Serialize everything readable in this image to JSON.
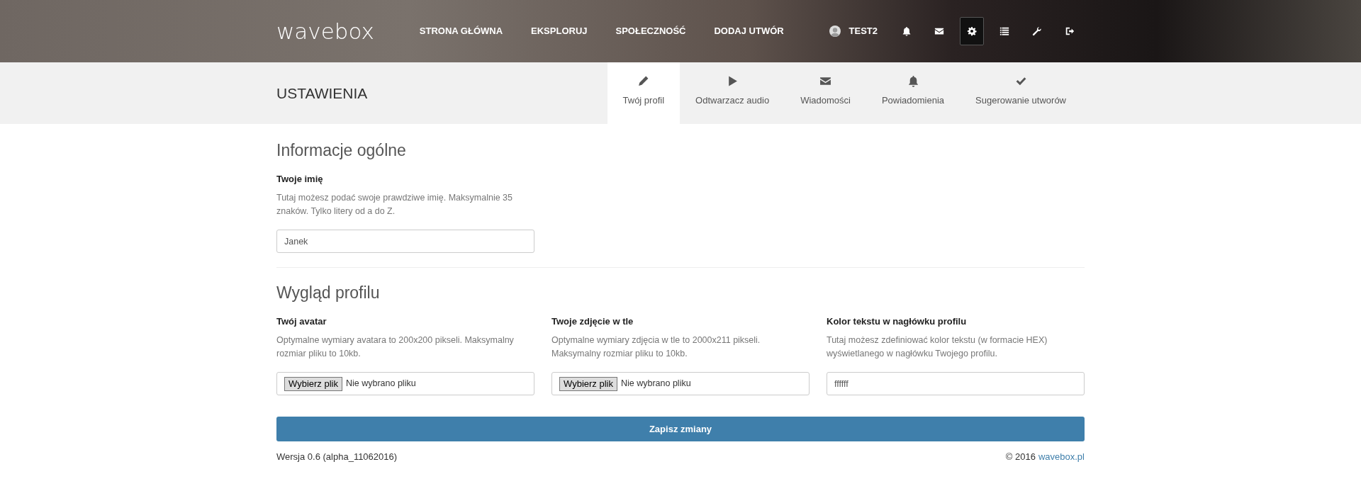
{
  "header": {
    "logo": "wavebox",
    "nav_links": [
      "STRONA GŁÓWNA",
      "EKSPLORUJ",
      "SPOŁECZNOŚĆ",
      "DODAJ UTWÓR"
    ],
    "user": {
      "name": "TEST2"
    },
    "icons": [
      {
        "kind": "bell",
        "selected": false
      },
      {
        "kind": "envelope",
        "selected": false
      },
      {
        "kind": "gear",
        "selected": true
      },
      {
        "kind": "list",
        "selected": false
      },
      {
        "kind": "wrench",
        "selected": false
      },
      {
        "kind": "signout",
        "selected": false
      }
    ]
  },
  "page_title": "USTAWIENIA",
  "tabs": [
    {
      "label": "Twój profil",
      "kind": "pencil",
      "selected": true
    },
    {
      "label": "Odtwarzacz audio",
      "kind": "play",
      "selected": false
    },
    {
      "label": "Wiadomości",
      "kind": "envelope",
      "selected": false
    },
    {
      "label": "Powiadomienia",
      "kind": "bell",
      "selected": false
    },
    {
      "label": "Sugerowanie utworów",
      "kind": "check",
      "selected": false
    }
  ],
  "sections": [
    {
      "title": "Informacje ogólne",
      "fields": [
        {
          "kind": "text",
          "label": "Twoje imię",
          "help": "Tutaj możesz podać swoje prawdziwe imię. Maksymalnie 35 znaków. Tylko litery od a do Z.",
          "value": "Janek"
        }
      ]
    },
    {
      "title": "Wygląd profilu",
      "fields": [
        {
          "kind": "file",
          "label": "Twój avatar",
          "help": "Optymalne wymiary avatara to 200x200 pikseli. Maksymalny rozmiar pliku to 10kb.",
          "button": "Wybierz plik",
          "status": "Nie wybrano pliku"
        },
        {
          "kind": "file",
          "label": "Twoje zdjęcie w tle",
          "help": "Optymalne wymiary zdjęcia w tle to 2000x211 pikseli. Maksymalny rozmiar pliku to 10kb.",
          "button": "Wybierz plik",
          "status": "Nie wybrano pliku"
        },
        {
          "kind": "text",
          "label": "Kolor tekstu w nagłówku profilu",
          "help": "Tutaj możesz zdefiniować kolor tekstu (w formacie HEX) wyświetlanego w nagłówku Twojego profilu.",
          "value": "ffffff"
        }
      ]
    }
  ],
  "save_button": "Zapisz zmiany",
  "footer": {
    "version": "Wersja 0.6 (alpha_11062016)",
    "copyright": "© 2016",
    "link": "wavebox.pl"
  }
}
